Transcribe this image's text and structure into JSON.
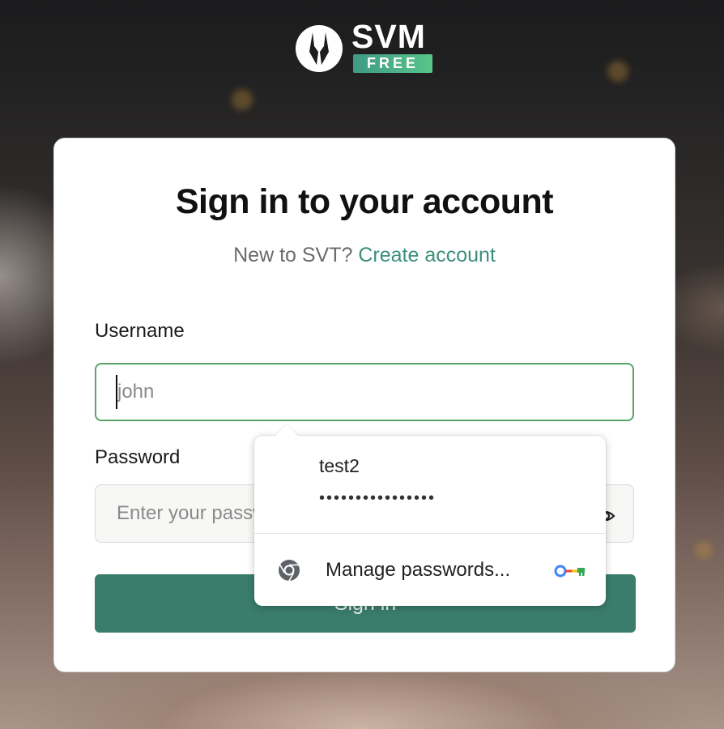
{
  "logo": {
    "name": "SVM",
    "badge": "FREE"
  },
  "form": {
    "title": "Sign in to your account",
    "subtitle_prefix": "New to SVT?",
    "create_link": "Create account",
    "username_label": "Username",
    "username_placeholder": "john",
    "password_label": "Password",
    "password_placeholder": "Enter your password",
    "signin_label": "Sign in"
  },
  "autofill": {
    "username": "test2",
    "password_mask": "••••••••••••••••",
    "manage_label": "Manage passwords..."
  },
  "colors": {
    "accent": "#3d8f7a",
    "button": "#3a7d6c",
    "focus_border": "#5aa469"
  },
  "icons": [
    "logo-mark-icon",
    "eye-icon",
    "chrome-icon",
    "key-icon"
  ]
}
